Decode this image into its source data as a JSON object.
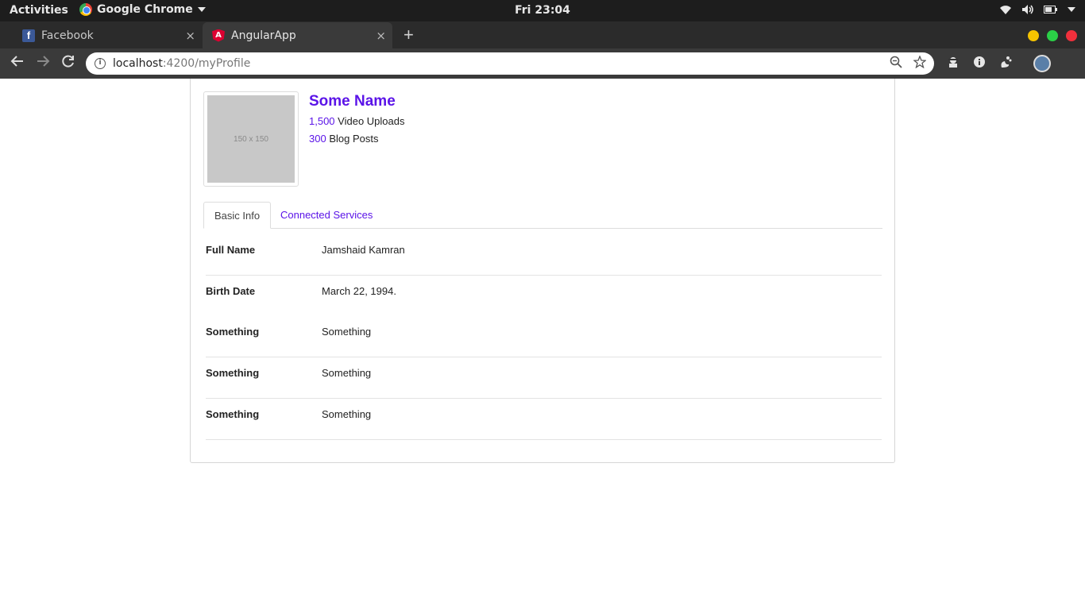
{
  "topbar": {
    "activities": "Activities",
    "app_name": "Google Chrome",
    "clock": "Fri 23:04"
  },
  "tabs": [
    {
      "title": "Facebook"
    },
    {
      "title": "AngularApp"
    }
  ],
  "tab_close_glyph": "×",
  "new_tab_glyph": "+",
  "address": {
    "host": "localhost",
    "rest": ":4200/myProfile"
  },
  "profile": {
    "image_placeholder": "150 x 150",
    "name": "Some Name",
    "stats": [
      {
        "value": "1,500",
        "label": "Video Uploads"
      },
      {
        "value": "300",
        "label": "Blog Posts"
      }
    ]
  },
  "profile_tabs": {
    "basic": "Basic Info",
    "connected": "Connected Services"
  },
  "info_rows": [
    {
      "label": "Full Name",
      "value": "Jamshaid Kamran"
    },
    {
      "label": "Birth Date",
      "value": "March 22, 1994."
    },
    {
      "label": "Something",
      "value": "Something"
    },
    {
      "label": "Something",
      "value": "Something"
    },
    {
      "label": "Something",
      "value": "Something"
    }
  ],
  "colors": {
    "accent": "#5b14e8",
    "topbar": "#1d1d1d",
    "toolbar": "#3a3a3a"
  },
  "icons": {
    "back": "arrow-left-icon",
    "forward": "arrow-right-icon",
    "reload": "reload-icon",
    "zoom": "zoom-icon",
    "bookmark": "star-icon"
  }
}
